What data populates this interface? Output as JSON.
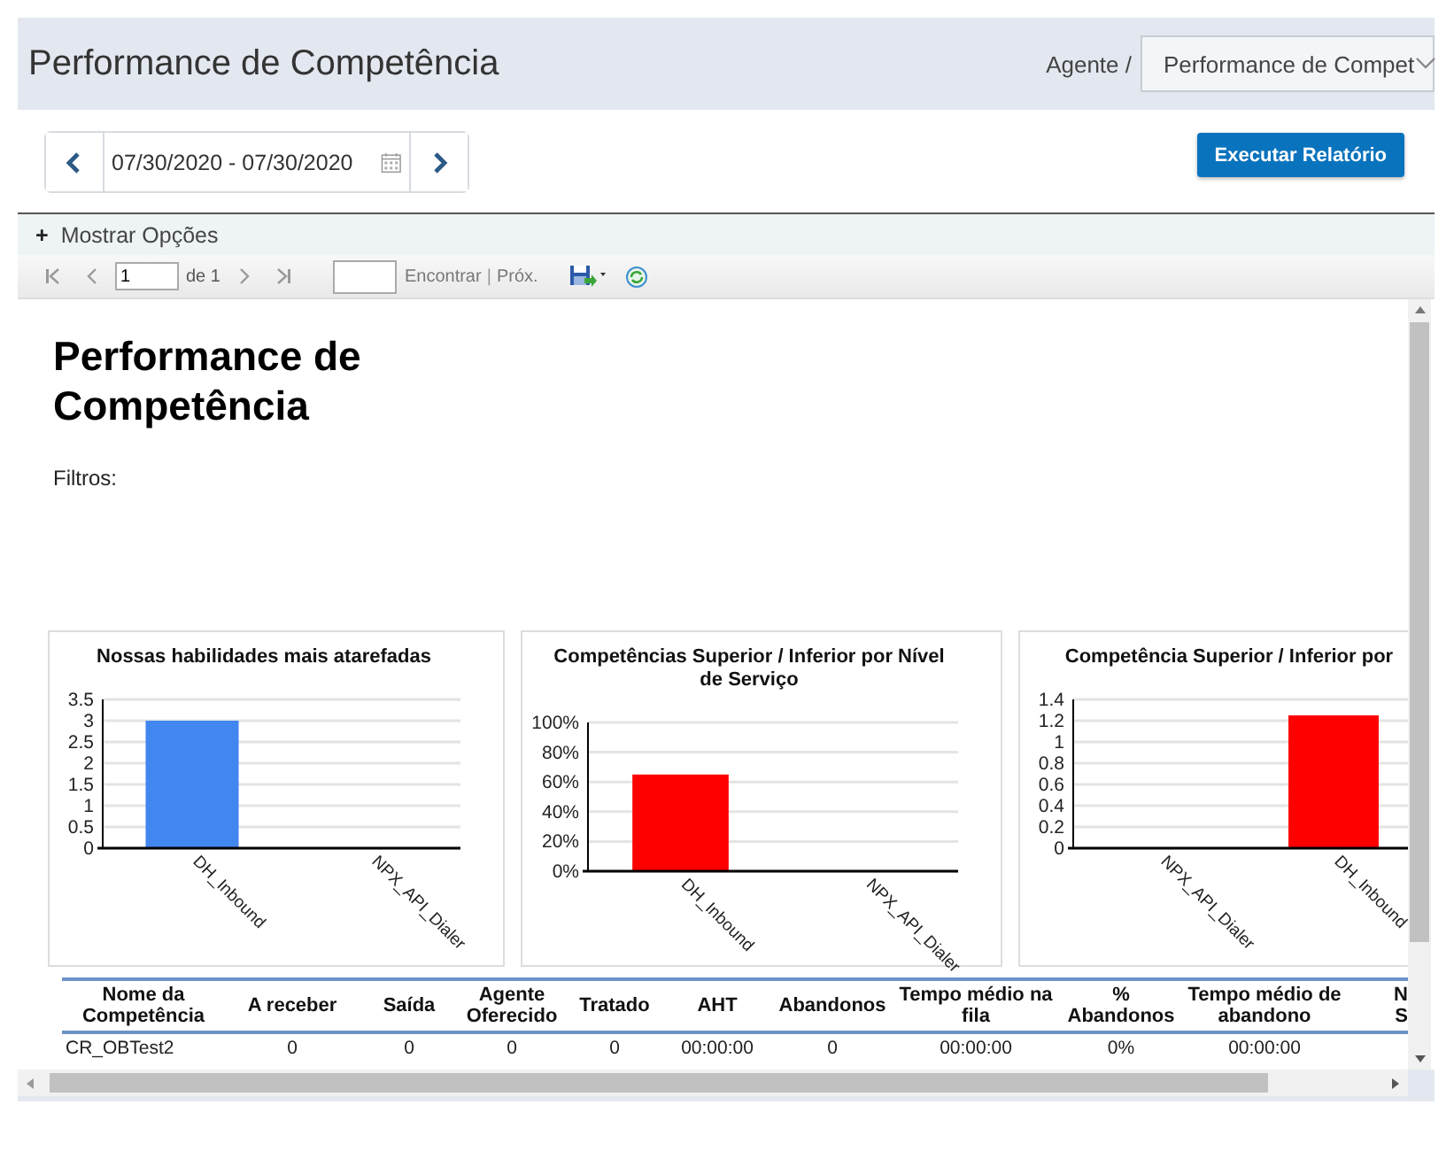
{
  "header": {
    "title": "Performance de Competência",
    "breadcrumb": "Agente /",
    "report_select": "Performance de Compet"
  },
  "date_range": {
    "value": "07/30/2020 - 07/30/2020"
  },
  "run_button": "Executar Relatório",
  "options_toggle": {
    "icon": "+",
    "label": "Mostrar Opções"
  },
  "toolbar": {
    "page": "1",
    "page_count": "de 1",
    "find_link": "Encontrar",
    "separator": "|",
    "next_link": "Próx."
  },
  "report": {
    "title": "Performance de Competência",
    "filters_label": "Filtros:",
    "charts": [
      {
        "chart_data": {
          "type": "bar",
          "title": "Nossas habilidades mais atarefadas",
          "categories": [
            "DH_Inbound",
            "NPX_API_Dialer"
          ],
          "series": [
            {
              "color": "#4286f0",
              "values": [
                3,
                0
              ]
            }
          ],
          "grid": true,
          "ylim": [
            0,
            3.5
          ],
          "yticks": [
            0,
            0.5,
            1,
            1.5,
            2,
            2.5,
            3,
            3.5
          ]
        }
      },
      {
        "chart_data": {
          "type": "bar",
          "title": "Competências Superior / Inferior por Nível de Serviço",
          "categories": [
            "DH_Inbound",
            "NPX_API_Dialer"
          ],
          "series": [
            {
              "color": "#ff0000",
              "values": [
                65,
                0
              ]
            }
          ],
          "grid": true,
          "ylim": [
            0,
            100
          ],
          "yticks": [
            {
              "value": 0,
              "label": "0%"
            },
            {
              "value": 20,
              "label": "20%"
            },
            {
              "value": 40,
              "label": "40%"
            },
            {
              "value": 60,
              "label": "60%"
            },
            {
              "value": 80,
              "label": "80%"
            },
            {
              "value": 100,
              "label": "100%"
            }
          ]
        }
      },
      {
        "chart_data": {
          "type": "bar",
          "title": "Competência Superior / Inferior por",
          "categories": [
            "NPX_API_Dialer",
            "DH_Inbound"
          ],
          "series": [
            {
              "color": "#ff0000",
              "values": [
                0,
                1.25
              ]
            }
          ],
          "grid": true,
          "ylim": [
            0,
            1.4
          ],
          "yticks": [
            0,
            0.2,
            0.4,
            0.6,
            0.8,
            1,
            1.2,
            1.4
          ]
        }
      }
    ],
    "table": {
      "columns": [
        "Nome da\nCompetência",
        "A receber",
        "Saída",
        "Agente\nOferecido",
        "Tratado",
        "AHT",
        "Abandonos",
        "Tempo médio na\nfila",
        "%\nAbandonos",
        "Tempo médio de\nabandono",
        "N\nS"
      ],
      "rows": [
        [
          "CR_OBTest2",
          "0",
          "0",
          "0",
          "0",
          "00:00:00",
          "0",
          "00:00:00",
          "0%",
          "00:00:00"
        ]
      ]
    }
  }
}
